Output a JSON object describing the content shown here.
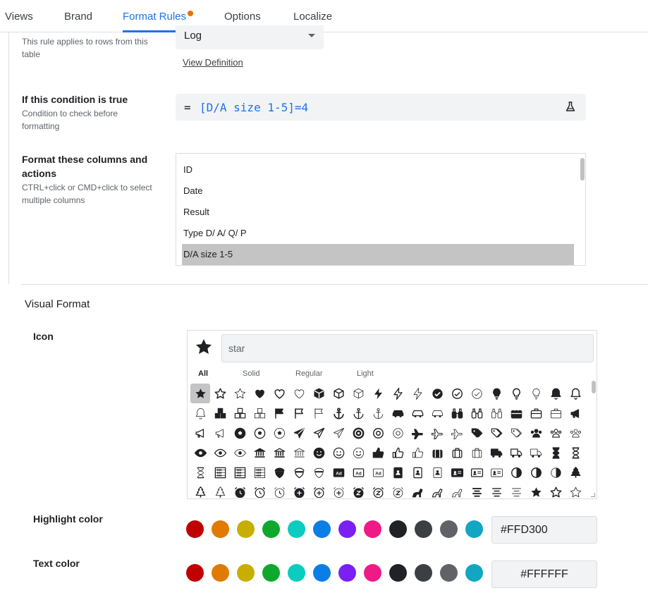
{
  "tabs": [
    {
      "label": "Views"
    },
    {
      "label": "Brand"
    },
    {
      "label": "Format Rules"
    },
    {
      "label": "Options"
    },
    {
      "label": "Localize"
    }
  ],
  "colors": {
    "accent": "#1a73e8",
    "unsaved_dot": "#e37400"
  },
  "table_rule": {
    "sub": "This rule applies to rows from this table",
    "value": "Log",
    "view_definition": "View Definition"
  },
  "condition": {
    "title": "If this condition is true",
    "sub": "Condition to check before formatting",
    "eq": "=",
    "expression": "[D/A size 1-5]=4",
    "icon": "flask-icon"
  },
  "columns": {
    "title": "Format these columns and actions",
    "sub": "CTRL+click or CMD+click to select multiple columns",
    "items": [
      "ID",
      "Date",
      "Result",
      "Type D/ A/ Q/ P",
      "D/A size 1-5"
    ],
    "selected": "D/A size 1-5"
  },
  "visual_format": {
    "title": "Visual Format",
    "icon_label": "Icon",
    "selected_icon": "star-icon",
    "search_value": "star",
    "icon_tabs": [
      "All",
      "Solid",
      "Regular",
      "Light"
    ],
    "active_icon_tab": "All",
    "highlight_label": "Highlight color",
    "highlight_value": "#FFD300",
    "text_color_label": "Text color",
    "text_color_value": "#FFFFFF",
    "palette": [
      "#c00000",
      "#e07a00",
      "#c8ae00",
      "#0fa82c",
      "#0ccbbf",
      "#0b7de6",
      "#7b1ff2",
      "#ee1a86",
      "#1f2226",
      "#3c4043",
      "#5f6368",
      "#12a6c2"
    ]
  }
}
